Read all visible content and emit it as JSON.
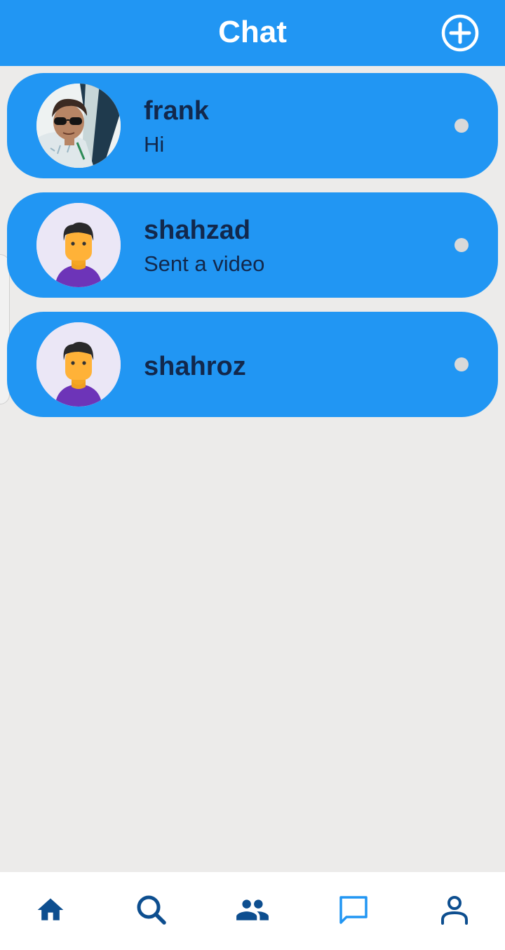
{
  "header": {
    "title": "Chat",
    "add_icon": "add-circle-icon"
  },
  "chats": [
    {
      "name": "frank",
      "message": "Hi",
      "avatar": "photo-avatar"
    },
    {
      "name": "shahzad",
      "message": "Sent a video",
      "avatar": "default-person-avatar"
    },
    {
      "name": "shahroz",
      "message": "",
      "avatar": "default-person-avatar"
    }
  ],
  "bottom_nav": {
    "items": [
      {
        "name": "home",
        "icon": "home-icon"
      },
      {
        "name": "search",
        "icon": "search-icon"
      },
      {
        "name": "people",
        "icon": "people-icon"
      },
      {
        "name": "chat",
        "icon": "chat-icon",
        "active": true
      },
      {
        "name": "profile",
        "icon": "person-icon"
      }
    ]
  },
  "colors": {
    "primary": "#2196f3",
    "background": "#ecebea",
    "text_dark": "#12284c",
    "nav_icon": "#0d4e8f",
    "nav_icon_active": "#2196f3",
    "status_dot": "#d9d9d9"
  }
}
